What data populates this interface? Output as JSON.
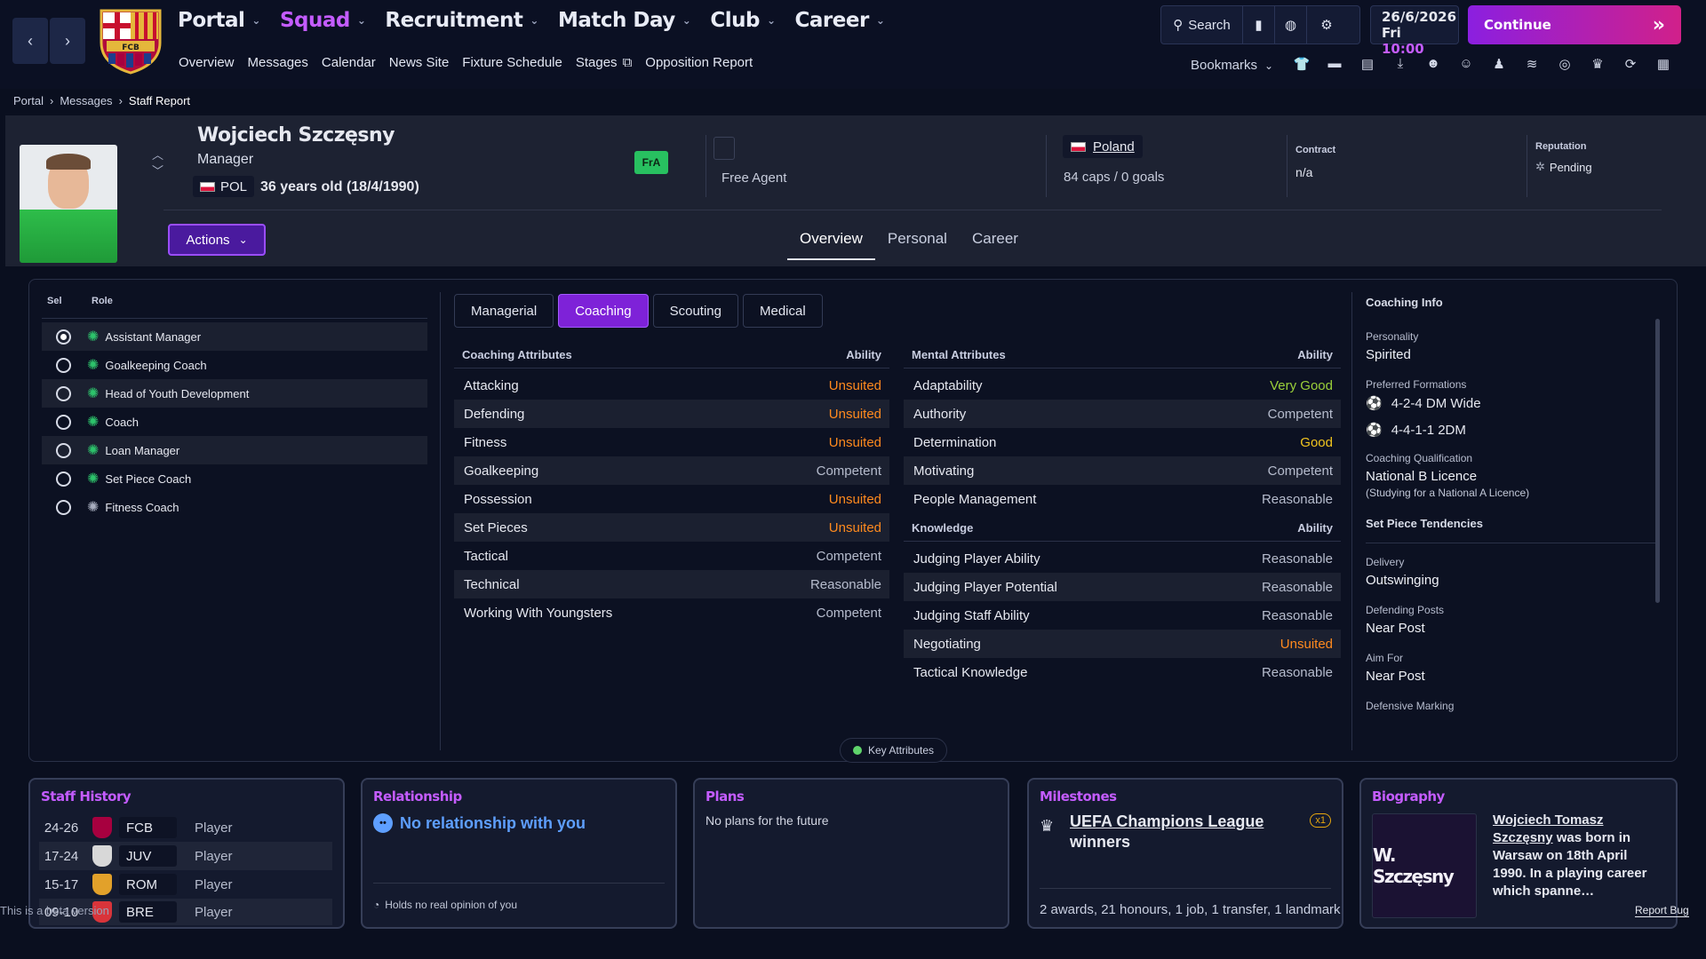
{
  "nav": {
    "menu": [
      {
        "label": "Portal",
        "active": false
      },
      {
        "label": "Squad",
        "active": true
      },
      {
        "label": "Recruitment",
        "active": false
      },
      {
        "label": "Match Day",
        "active": false
      },
      {
        "label": "Club",
        "active": false
      },
      {
        "label": "Career",
        "active": false
      }
    ],
    "submenu": [
      "Overview",
      "Messages",
      "Calendar",
      "News Site",
      "Fixture Schedule",
      "Stages",
      "Opposition Report"
    ],
    "search_label": "Search",
    "date": "26/6/2026",
    "day": "Fri",
    "time": "10:00",
    "continue_label": "Continue",
    "bookmarks_label": "Bookmarks",
    "crest_text": "FCB"
  },
  "breadcrumb": [
    "Portal",
    "Messages",
    "Staff Report"
  ],
  "profile": {
    "name": "Wojciech Szczęsny",
    "role": "Manager",
    "nationality_code": "POL",
    "age_text": "36 years old (18/4/1990)",
    "status_badge": "FrA",
    "club_status": "Free Agent",
    "country": "Poland",
    "caps": "84 caps / 0 goals",
    "contract_label": "Contract",
    "contract_value": "n/a",
    "reputation_label": "Reputation",
    "reputation_value": "Pending",
    "actions_label": "Actions",
    "tabs": [
      "Overview",
      "Personal",
      "Career"
    ],
    "active_tab": "Overview"
  },
  "roles": {
    "sel_header": "Sel",
    "role_header": "Role",
    "items": [
      {
        "label": "Assistant Manager",
        "selected": true
      },
      {
        "label": "Goalkeeping Coach",
        "selected": false
      },
      {
        "label": "Head of Youth Development",
        "selected": false
      },
      {
        "label": "Coach",
        "selected": false
      },
      {
        "label": "Loan Manager",
        "selected": false
      },
      {
        "label": "Set Piece Coach",
        "selected": false
      },
      {
        "label": "Fitness Coach",
        "selected": false
      }
    ]
  },
  "attr_tabs": [
    "Managerial",
    "Coaching",
    "Scouting",
    "Medical"
  ],
  "active_attr_tab": "Coaching",
  "coaching": {
    "title": "Coaching Attributes",
    "ability_header": "Ability",
    "rows": [
      {
        "name": "Attacking",
        "value": "Unsuited"
      },
      {
        "name": "Defending",
        "value": "Unsuited"
      },
      {
        "name": "Fitness",
        "value": "Unsuited"
      },
      {
        "name": "Goalkeeping",
        "value": "Competent"
      },
      {
        "name": "Possession",
        "value": "Unsuited"
      },
      {
        "name": "Set Pieces",
        "value": "Unsuited"
      },
      {
        "name": "Tactical",
        "value": "Competent"
      },
      {
        "name": "Technical",
        "value": "Reasonable"
      },
      {
        "name": "Working With Youngsters",
        "value": "Competent"
      }
    ]
  },
  "mental": {
    "title": "Mental Attributes",
    "ability_header": "Ability",
    "rows": [
      {
        "name": "Adaptability",
        "value": "Very Good"
      },
      {
        "name": "Authority",
        "value": "Competent"
      },
      {
        "name": "Determination",
        "value": "Good"
      },
      {
        "name": "Motivating",
        "value": "Competent"
      },
      {
        "name": "People Management",
        "value": "Reasonable"
      }
    ]
  },
  "knowledge": {
    "title": "Knowledge",
    "ability_header": "Ability",
    "rows": [
      {
        "name": "Judging Player Ability",
        "value": "Reasonable"
      },
      {
        "name": "Judging Player Potential",
        "value": "Reasonable"
      },
      {
        "name": "Judging Staff Ability",
        "value": "Reasonable"
      },
      {
        "name": "Negotiating",
        "value": "Unsuited"
      },
      {
        "name": "Tactical Knowledge",
        "value": "Reasonable"
      }
    ]
  },
  "key_attributes_label": "Key Attributes",
  "coaching_info": {
    "title": "Coaching Info",
    "personality_label": "Personality",
    "personality": "Spirited",
    "formations_label": "Preferred Formations",
    "formations": [
      "4-2-4 DM Wide",
      "4-4-1-1 2DM"
    ],
    "qualification_label": "Coaching Qualification",
    "qualification": "National B Licence",
    "qualification_note": "(Studying for a National A Licence)",
    "set_piece_title": "Set Piece Tendencies",
    "delivery_label": "Delivery",
    "delivery": "Outswinging",
    "def_posts_label": "Defending Posts",
    "def_posts": "Near Post",
    "aim_label": "Aim For",
    "aim": "Near Post",
    "def_marking_label": "Defensive Marking"
  },
  "staff_history": {
    "title": "Staff History",
    "rows": [
      {
        "years": "24-26",
        "club": "FCB",
        "role": "Player",
        "color": "#a7003f"
      },
      {
        "years": "17-24",
        "club": "JUV",
        "role": "Player",
        "color": "#d8d8d8"
      },
      {
        "years": "15-17",
        "club": "ROM",
        "role": "Player",
        "color": "#e2a12a"
      },
      {
        "years": "09-10",
        "club": "BRE",
        "role": "Player",
        "color": "#d9343a"
      }
    ]
  },
  "relationship": {
    "title": "Relationship",
    "main": "No relationship with you",
    "footer": "Holds no real opinion of you"
  },
  "plans": {
    "title": "Plans",
    "text": "No plans for the future"
  },
  "milestones": {
    "title": "Milestones",
    "competition": "UEFA Champions League",
    "achievement": "winners",
    "count": "x1",
    "summary": "2 awards, 21 honours, 1 job, 1 transfer, 1 landmark"
  },
  "biography": {
    "title": "Biography",
    "pic_text": "W. Szczęsny",
    "link_name": "Wojciech Tomasz Szczęsny",
    "text": "was born in Warsaw on 18th April 1990. In a playing career which spanne…"
  },
  "watermark": "This is a beta version",
  "report_bug": "Report Bug",
  "colors": {
    "accent": "#c45cff",
    "unsuited": "#ff8a1e",
    "very_good": "#9bd13a",
    "good": "#f2c51f",
    "badge_green": "#28c060"
  }
}
